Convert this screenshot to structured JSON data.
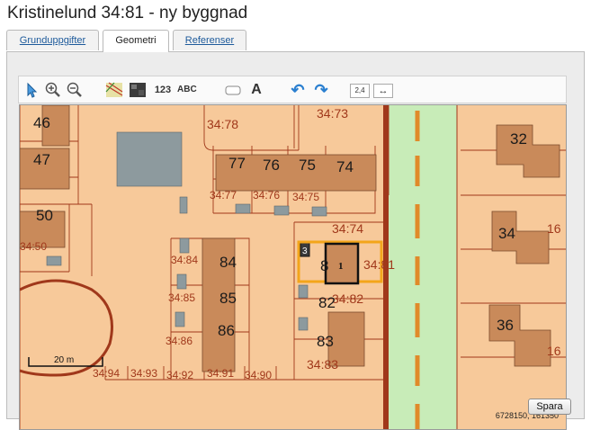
{
  "window": {
    "title": "Kristinelund 34:81 - ny byggnad"
  },
  "tabs": [
    {
      "label": "Grunduppgifter",
      "active": false
    },
    {
      "label": "Geometri",
      "active": true
    },
    {
      "label": "Referenser",
      "active": false
    }
  ],
  "toolbar": {
    "tools": [
      {
        "icon": "select-arrow-icon"
      },
      {
        "icon": "zoom-in-icon"
      },
      {
        "icon": "zoom-out-icon"
      },
      {
        "icon": "map-layer-icon"
      },
      {
        "icon": "orthophoto-layer-icon"
      },
      {
        "icon": "numbered-points-icon",
        "glyph": "123"
      },
      {
        "icon": "text-label-icon",
        "glyph": "ABC"
      },
      {
        "icon": "rectangle-tool-icon"
      },
      {
        "icon": "text-tool-icon",
        "glyph": "A"
      },
      {
        "icon": "undo-icon",
        "glyph": "↶"
      },
      {
        "icon": "redo-icon",
        "glyph": "↷"
      },
      {
        "icon": "measure-area-icon",
        "glyph": "2,4"
      },
      {
        "icon": "measure-distance-icon",
        "glyph": "↔"
      }
    ]
  },
  "map": {
    "scale_label": "20 m",
    "coordinates": "6728150, 161350",
    "colors": {
      "land": "#f7c99a",
      "road": "#c8ecb8",
      "building": "#c98a5a",
      "line": "#a0381b",
      "selection": "#f3a51a"
    },
    "labels": {
      "plot_34_78": "34:78",
      "plot_34_73": "34:73",
      "plot_34_77": "34:77",
      "plot_34_76": "34:76",
      "plot_34_75": "34:75",
      "plot_34_74": "34:74",
      "plot_34_84": "34:84",
      "plot_34_85": "34:85",
      "plot_34_86": "34:86",
      "plot_34_82": "34:82",
      "plot_34_81": "34:81",
      "plot_34_83": "34:83",
      "plot_34_50": "34:50",
      "plot_34_94": "34:94",
      "plot_34_93": "34:93",
      "plot_34_92": "34:92",
      "plot_34_91": "34:91",
      "plot_34_90": "34:90",
      "num_46": "46",
      "num_47": "47",
      "num_50": "50",
      "num_77": "77",
      "num_76": "76",
      "num_75": "75",
      "num_74": "74",
      "num_84": "84",
      "num_85": "85",
      "num_86": "86",
      "num_82": "82",
      "num_83": "83",
      "num_81": "8",
      "num_32": "32",
      "num_34": "34",
      "num_36": "36",
      "edge_16_top": "16",
      "edge_16_mid": "16",
      "edge_16_bottom": "16",
      "new_building": "1",
      "small_building": "3"
    }
  },
  "footer": {
    "save_label": "Spara"
  }
}
